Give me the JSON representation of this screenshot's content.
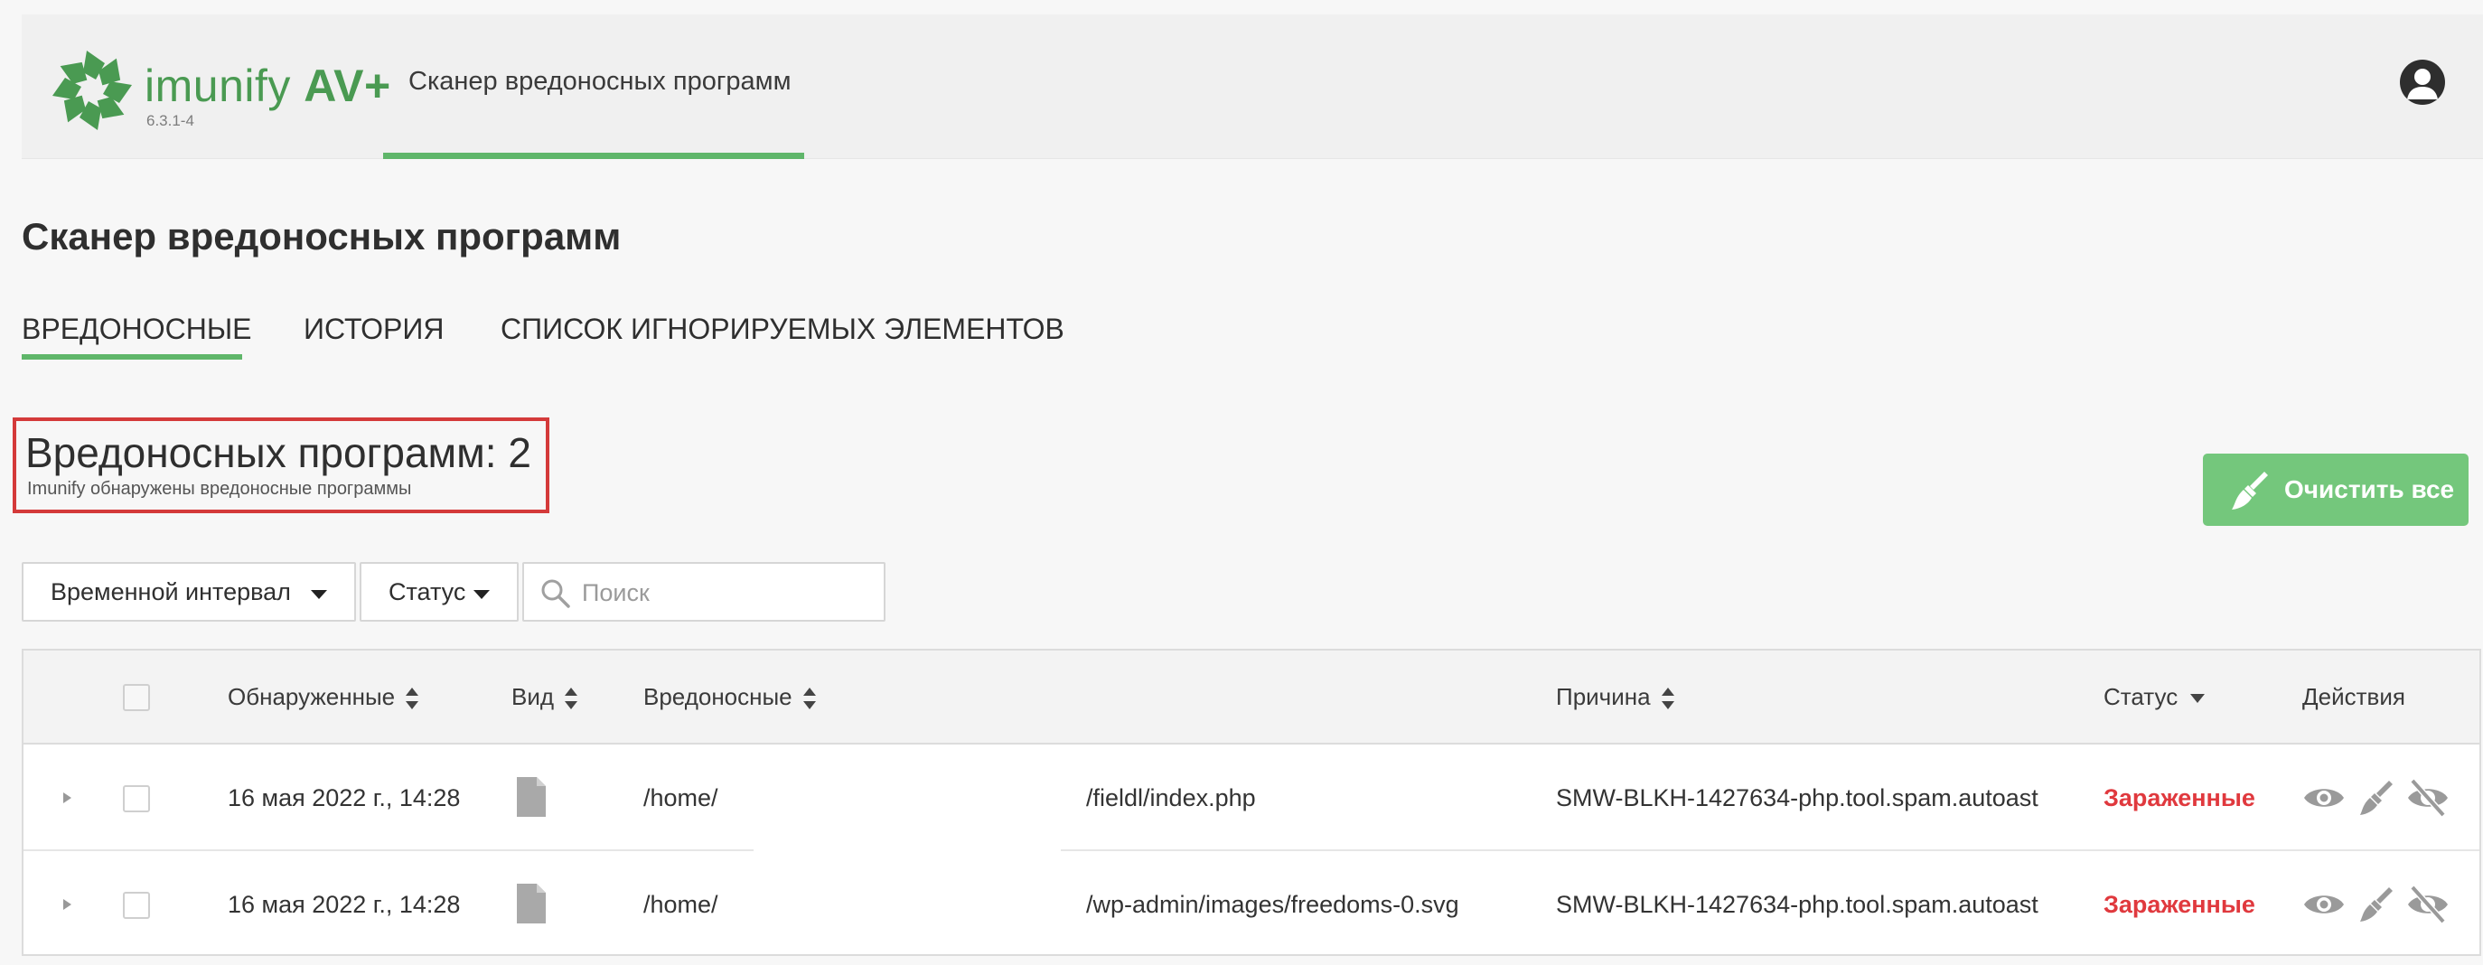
{
  "header": {
    "logo_text": "imunify",
    "logo_text_bold": "AV+",
    "version": "6.3.1-4",
    "app_tab": "Сканер вредоносных программ"
  },
  "page": {
    "title": "Сканер вредоносных программ"
  },
  "tabs": [
    {
      "label": "ВРЕДОНОСНЫЕ",
      "active": true
    },
    {
      "label": "ИСТОРИЯ",
      "active": false
    },
    {
      "label": "СПИСОК ИГНОРИРУЕМЫХ ЭЛЕМЕНТОВ",
      "active": false
    }
  ],
  "summary": {
    "count_label": "Вредоносных программ: 2",
    "subtitle": "Imunify обнаружены вредоносные программы",
    "highlight_color": "#d43a3a"
  },
  "toolbar": {
    "clean_all_label": "Очистить все",
    "clean_all_icon": "broom-icon",
    "accent_color": "#74c77c"
  },
  "filters": {
    "time_interval": "Временной интервал",
    "status": "Статус",
    "search_placeholder": "Поиск"
  },
  "table": {
    "columns": {
      "detected": "Обнаруженные",
      "type": "Вид",
      "malware": "Вредоносные",
      "reason": "Причина",
      "status": "Статус",
      "actions": "Действия"
    },
    "rows": [
      {
        "date": "16 мая 2022 г., 14:28",
        "type_icon": "file-icon",
        "path_start": "/home/",
        "path_end": "/fieldl/index.php",
        "reason": "SMW-BLKH-1427634-php.tool.spam.autoast",
        "status": "Зараженные"
      },
      {
        "date": "16 мая 2022 г., 14:28",
        "type_icon": "file-icon",
        "path_start": "/home/",
        "path_end": "/wp-admin/images/freedoms-0.svg",
        "reason": "SMW-BLKH-1427634-php.tool.spam.autoast",
        "status": "Зараженные"
      }
    ],
    "status_color": "#e0393e"
  }
}
